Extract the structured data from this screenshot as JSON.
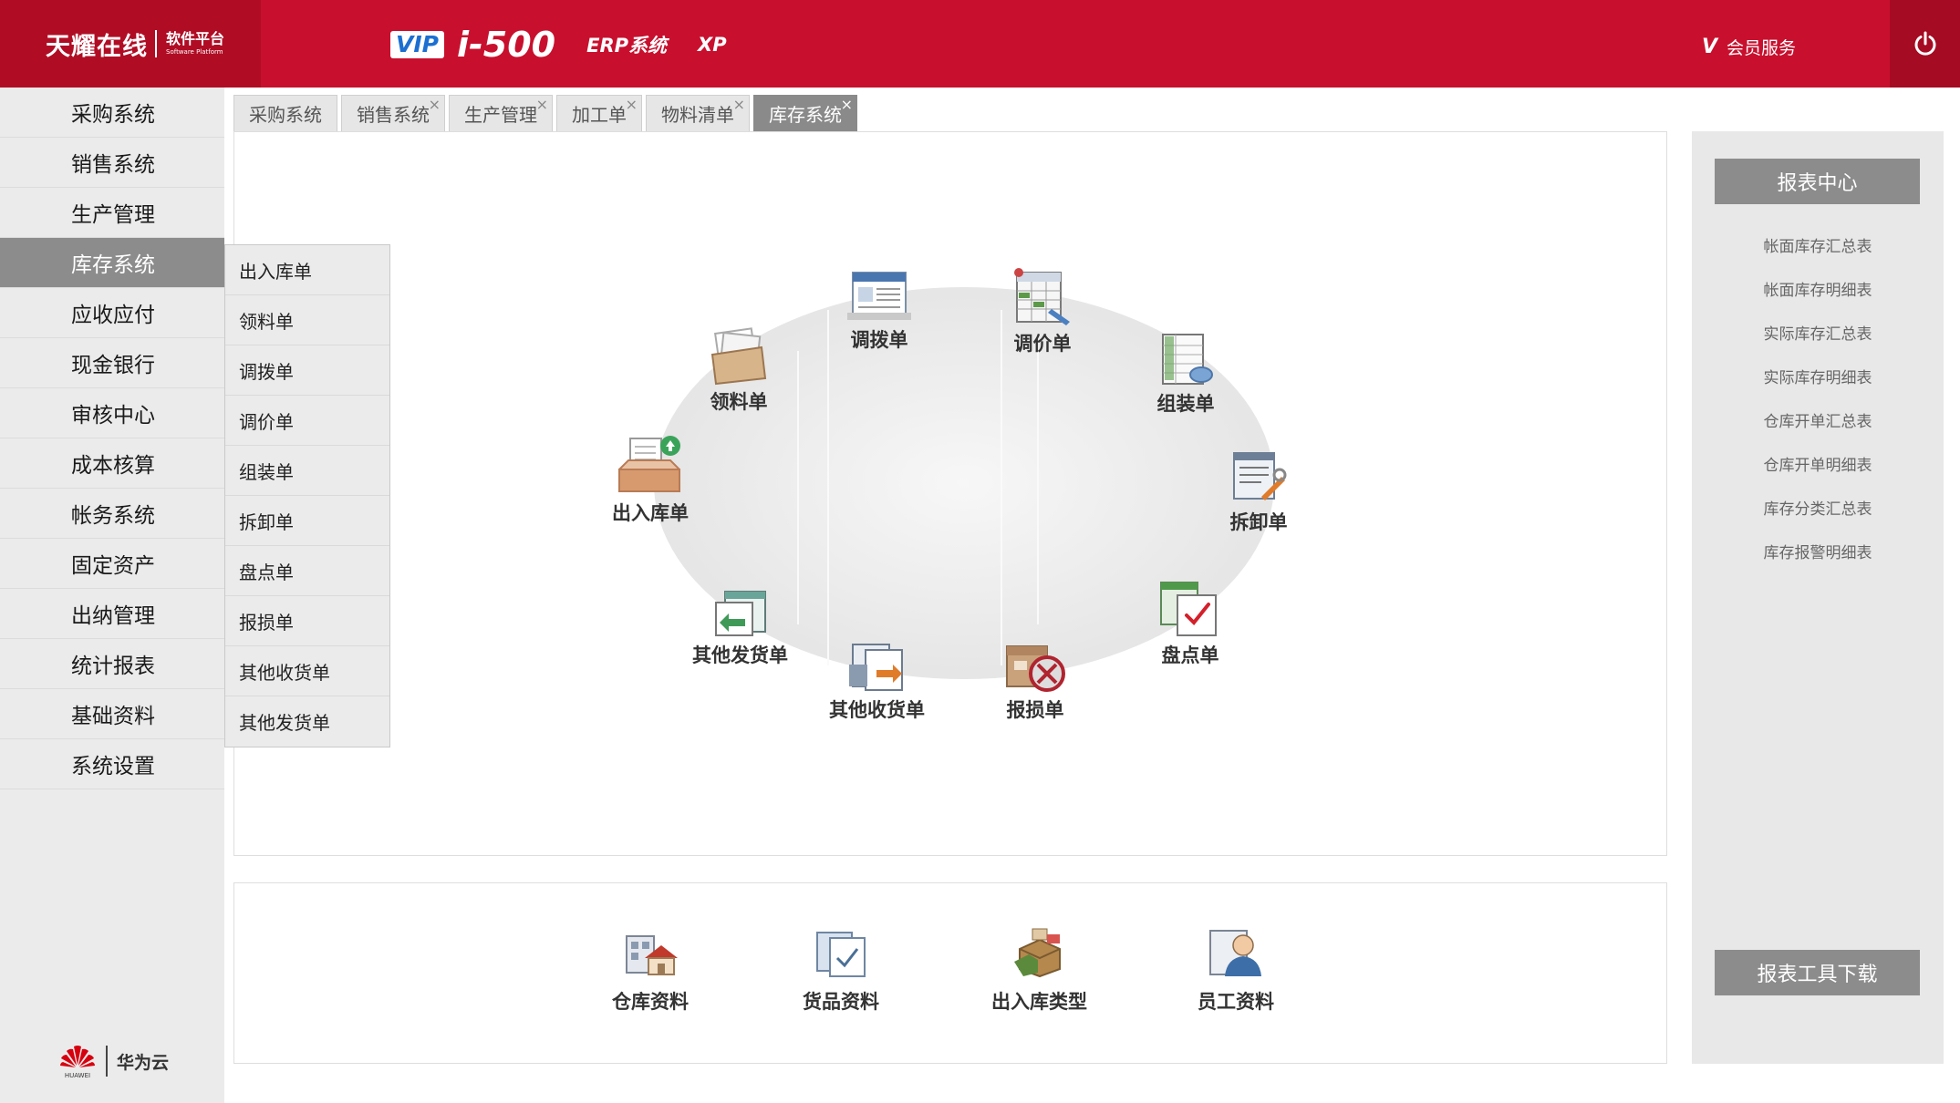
{
  "header": {
    "logo_text": "天耀在线",
    "logo_sub": "软件平台",
    "logo_sub_en": "Software Platform",
    "vip": "VIP",
    "product": "i-500",
    "erp": "ERP系统",
    "xp": "XP",
    "member_v": "V",
    "member_service": "会员服务",
    "accent_color": "#c8102e"
  },
  "sidebar": {
    "items": [
      {
        "label": "采购系统"
      },
      {
        "label": "销售系统"
      },
      {
        "label": "生产管理"
      },
      {
        "label": "库存系统",
        "active": true
      },
      {
        "label": "应收应付"
      },
      {
        "label": "现金银行"
      },
      {
        "label": "审核中心"
      },
      {
        "label": "成本核算"
      },
      {
        "label": "帐务系统"
      },
      {
        "label": "固定资产"
      },
      {
        "label": "出纳管理"
      },
      {
        "label": "统计报表"
      },
      {
        "label": "基础资料"
      },
      {
        "label": "系统设置"
      }
    ],
    "partner_logo_text": "HUAWEI",
    "partner": "华为云"
  },
  "submenu": {
    "items": [
      "出入库单",
      "领料单",
      "调拨单",
      "调价单",
      "组装单",
      "拆卸单",
      "盘点单",
      "报损单",
      "其他收货单",
      "其他发货单"
    ]
  },
  "tabs": [
    {
      "label": "采购系统"
    },
    {
      "label": "销售系统",
      "close": "×"
    },
    {
      "label": "生产管理",
      "close": "×"
    },
    {
      "label": "加工单",
      "close": "×"
    },
    {
      "label": "物料清单",
      "close": "×"
    },
    {
      "label": "库存系统",
      "close": "×",
      "active": true
    }
  ],
  "flow": {
    "nodes": [
      "出入库单",
      "领料单",
      "调拨单",
      "调价单",
      "组装单",
      "拆卸单",
      "盘点单",
      "报损单",
      "其他收货单",
      "其他发货单"
    ]
  },
  "quick": {
    "items": [
      "仓库资料",
      "货品资料",
      "出入库类型",
      "员工资料"
    ]
  },
  "report_center": {
    "title": "报表中心",
    "items": [
      "帐面库存汇总表",
      "帐面库存明细表",
      "实际库存汇总表",
      "实际库存明细表",
      "仓库开单汇总表",
      "仓库开单明细表",
      "库存分类汇总表",
      "库存报警明细表"
    ],
    "download": "报表工具下载"
  }
}
